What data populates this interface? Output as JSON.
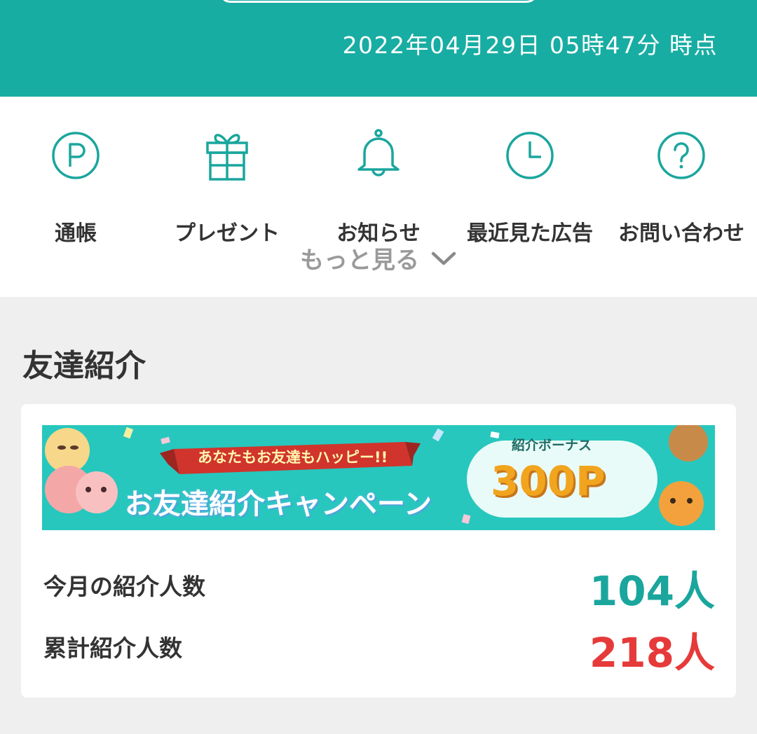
{
  "header": {
    "timestamp": "2022年04月29日 05時47分 時点"
  },
  "menu": {
    "items": [
      {
        "label": "通帳",
        "icon": "points-p-icon"
      },
      {
        "label": "プレゼント",
        "icon": "gift-icon"
      },
      {
        "label": "お知らせ",
        "icon": "bell-icon"
      },
      {
        "label": "最近見た広告",
        "icon": "clock-icon"
      },
      {
        "label": "お問い合わせ",
        "icon": "question-icon"
      }
    ],
    "more_label": "もっと見る"
  },
  "referral": {
    "section_title": "友達紹介",
    "banner": {
      "ribbon_text": "あなたもお友達もハッピー!!",
      "campaign_text": "お友達紹介キャンペーン",
      "bonus_label": "紹介ボーナス",
      "bonus_amount": "300P"
    },
    "stats": [
      {
        "label": "今月の紹介人数",
        "value": "104人",
        "color": "#1aa69d"
      },
      {
        "label": "累計紹介人数",
        "value": "218人",
        "color": "#e63a3a"
      }
    ]
  },
  "colors": {
    "brand": "#18ada3",
    "accent_red": "#e63a3a",
    "page_bg": "#efefef"
  }
}
